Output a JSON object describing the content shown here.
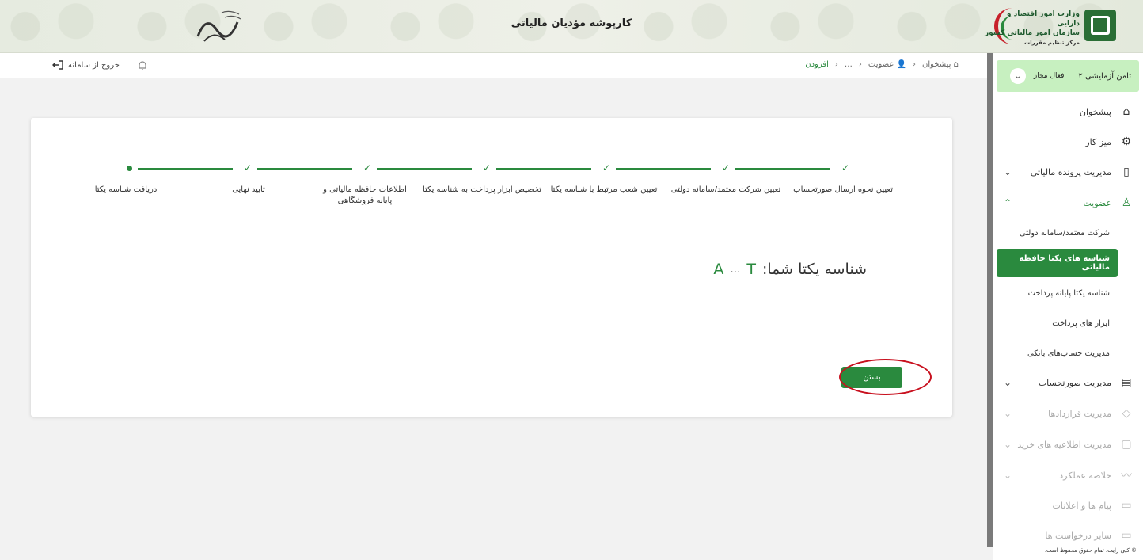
{
  "header": {
    "app_title": "کارپوشه مؤدیان مالیاتی",
    "org_line1": "وزارت امور اقتصاد و دارایی",
    "org_line2": "سازمان امور مالیاتی کشور",
    "org_line3": "مرکز تنظیم مقررات",
    "slogan_calligraphy": "تولید"
  },
  "subbar": {
    "logout_label": "خروج از سامانه",
    "breadcrumb": [
      "پیشخوان",
      "عضویت",
      "…",
      "افزودن"
    ]
  },
  "sidebar": {
    "profile_name": "ثامن آزمایشی ۲",
    "profile_status": "فعال مجاز",
    "items": [
      {
        "label": "پیشخوان",
        "icon": "home-icon"
      },
      {
        "label": "میز کار",
        "icon": "workflow-icon"
      },
      {
        "label": "مدیریت پرونده مالیاتی",
        "icon": "file-icon"
      },
      {
        "label": "عضویت",
        "icon": "user-icon"
      },
      {
        "label": "مدیریت صورتحساب",
        "icon": "invoice-icon"
      },
      {
        "label": "مدیریت قراردادها",
        "icon": "handshake-icon"
      },
      {
        "label": "مدیریت اطلاعیه های خرید",
        "icon": "bag-icon"
      },
      {
        "label": "خلاصه عملکرد",
        "icon": "chart-icon"
      },
      {
        "label": "پیام ها و اعلانات",
        "icon": "message-icon"
      },
      {
        "label": "سایر درخواست ها",
        "icon": "chat-icon"
      }
    ],
    "subitems": [
      "شرکت معتمد/سامانه دولتی",
      "شناسه های یکتا حافظه مالیاتی",
      "شناسه یکتا پایانه پرداخت",
      "ابزار های پرداخت",
      "مدیریت حساب‌های بانکی"
    ],
    "copyright": "© کپی رایت. تمام حقوق محفوظ است."
  },
  "stepper": {
    "steps": [
      "تعیین نحوه ارسال صورتحساب",
      "تعیین شرکت معتمد/سامانه دولتی",
      "تعیین شعب مرتبط با شناسه یکتا",
      "تخصیص ابزار پرداخت به شناسه یکتا",
      "اطلاعات حافظه مالیاتی و پایانه فروشگاهی",
      "تایید نهایی",
      "دریافت شناسه یکتا"
    ]
  },
  "result": {
    "label": "شناسه یکتا شما:",
    "value_start": "T",
    "ellipsis": "…",
    "value_end": "A"
  },
  "actions": {
    "close_label": "بستن"
  },
  "colors": {
    "accent": "#2a8a3e",
    "highlight": "#c8101e"
  }
}
